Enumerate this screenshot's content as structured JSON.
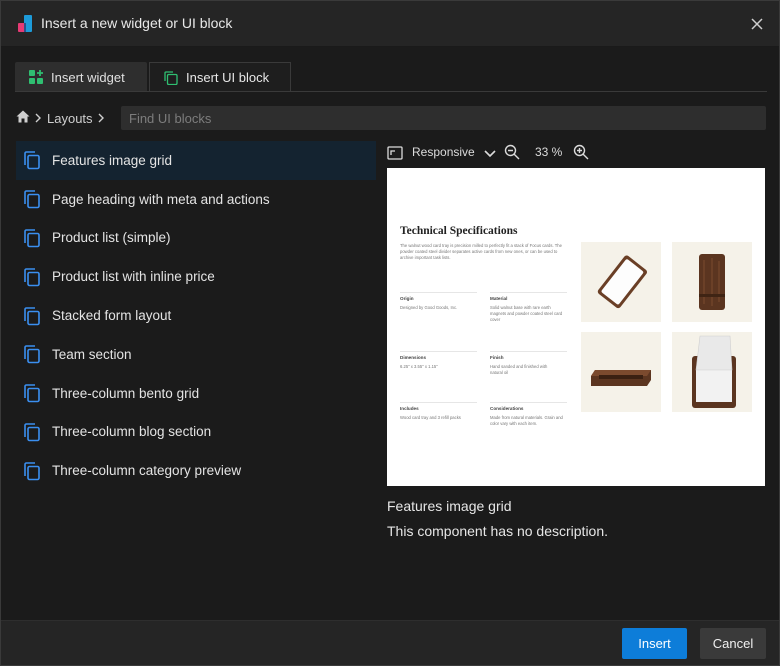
{
  "dialog": {
    "title": "Insert a new widget or UI block"
  },
  "tabs": [
    {
      "label": "Insert widget"
    },
    {
      "label": "Insert UI block"
    }
  ],
  "breadcrumb": {
    "home_icon": "home-icon",
    "layouts_label": "Layouts"
  },
  "search": {
    "placeholder": "Find UI blocks"
  },
  "blocks": [
    {
      "label": "Features image grid"
    },
    {
      "label": "Page heading with meta and actions"
    },
    {
      "label": "Product list (simple)"
    },
    {
      "label": "Product list with inline price"
    },
    {
      "label": "Stacked form layout"
    },
    {
      "label": "Team section"
    },
    {
      "label": "Three-column bento grid"
    },
    {
      "label": "Three-column blog section"
    },
    {
      "label": "Three-column category preview"
    }
  ],
  "preview_toolbar": {
    "mode": "Responsive",
    "zoom": "33 %"
  },
  "preview": {
    "title": "Technical Specifications",
    "intro": "The walnut wood card tray is precision milled to perfectly fit a stack of Focus cards. The powder coated steel divider separates active cards from new ones, or can be used to archive important task lists.",
    "specs": [
      {
        "label": "Origin",
        "text": "Designed by Good Goods, Inc."
      },
      {
        "label": "Material",
        "text": "Solid walnut base with rare earth magnets and powder coated steel card cover"
      },
      {
        "label": "Dimensions",
        "text": "6.25\" x 3.55\" x 1.15\""
      },
      {
        "label": "Finish",
        "text": "Hand sanded and finished with natural oil"
      },
      {
        "label": "Includes",
        "text": "Wood card tray and 3 refill packs"
      },
      {
        "label": "Considerations",
        "text": "Made from natural materials. Grain and color vary with each item."
      }
    ]
  },
  "description": {
    "title": "Features image grid",
    "text": "This component has no description."
  },
  "footer": {
    "insert_label": "Insert",
    "cancel_label": "Cancel"
  },
  "colors": {
    "accent": "#0d7dd9",
    "widget_icon": "#2fbf71",
    "block_icon": "#3b8ff0",
    "selected_bg": "#142330"
  }
}
